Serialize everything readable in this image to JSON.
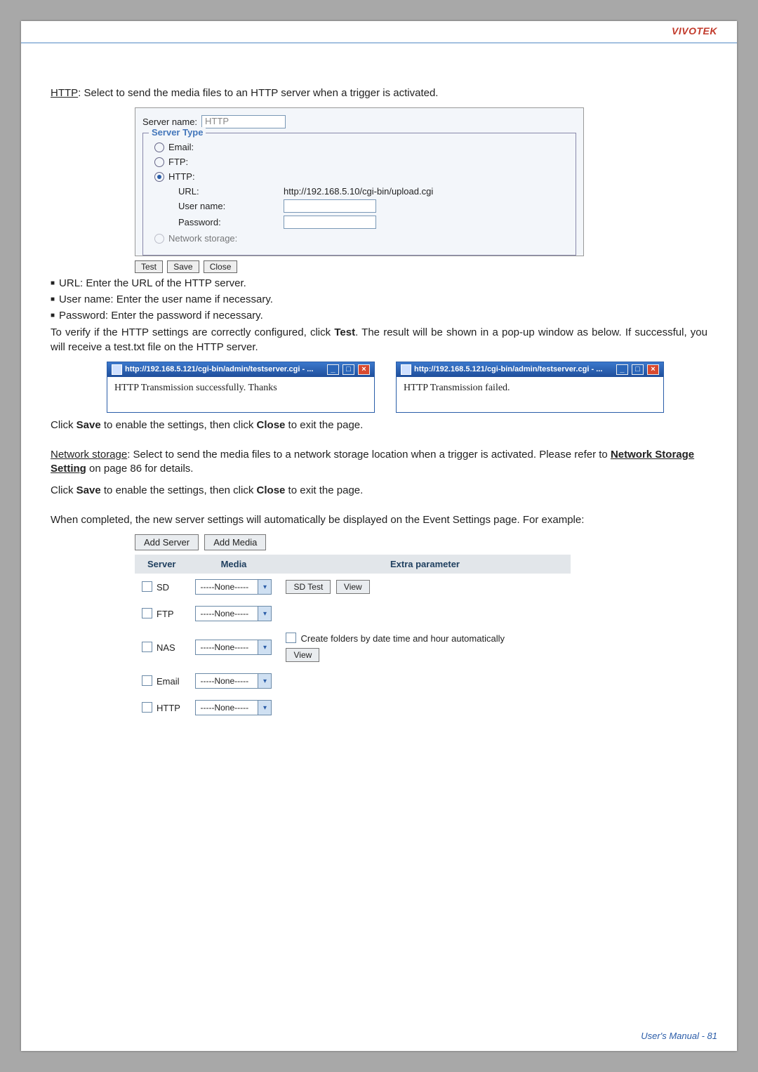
{
  "brand": "VIVOTEK",
  "http_intro_prefix": "HTTP",
  "http_intro_rest": ": Select to send the media files to an HTTP server when a trigger is activated.",
  "form": {
    "server_name_label": "Server name:",
    "server_name_value": "HTTP",
    "legend": "Server Type",
    "opt_email": "Email:",
    "opt_ftp": "FTP:",
    "opt_http": "HTTP:",
    "url_label": "URL:",
    "url_value": "http://192.168.5.10/cgi-bin/upload.cgi",
    "user_label": "User name:",
    "pass_label": "Password:",
    "opt_ns": "Network storage:",
    "btn_test": "Test",
    "btn_save": "Save",
    "btn_close": "Close"
  },
  "bullets": {
    "b1": "URL: Enter the URL of the HTTP server.",
    "b2": "User name: Enter the user name if necessary.",
    "b3": "Password: Enter the password if necessary."
  },
  "verify_text_1": "To verify if the HTTP settings are correctly configured, click ",
  "verify_test": "Test",
  "verify_text_2": ". The result will be shown in a pop-up window as below. If successful, you will receive a test.txt file on the HTTP server.",
  "popup": {
    "title_url": "http://192.168.5.121/cgi-bin/admin/testserver.cgi - ...",
    "success": "HTTP Transmission successfully. Thanks",
    "failed": "HTTP Transmission failed."
  },
  "save_line_1a": "Click ",
  "save_word": "Save",
  "save_line_1b": " to enable the settings, then click ",
  "close_word": "Close",
  "save_line_1c": " to exit the page.",
  "ns_prefix": "Network storage",
  "ns_rest_a": ": Select to send the media files to a network storage location when a trigger is activated. Please refer to ",
  "ns_link": "Network Storage Setting",
  "ns_rest_b": " on page 86 for details.",
  "completed_text": "When completed, the new server settings will automatically be displayed on the Event Settings page. For example:",
  "event": {
    "add_server": "Add Server",
    "add_media": "Add Media",
    "h_server": "Server",
    "h_media": "Media",
    "h_extra": "Extra parameter",
    "none": "-----None-----",
    "sd": "SD",
    "ftp": "FTP",
    "nas": "NAS",
    "email": "Email",
    "http": "HTTP",
    "sd_test": "SD Test",
    "view": "View",
    "nas_auto": "Create folders by date time and hour automatically"
  },
  "footer": "User's Manual - 81"
}
